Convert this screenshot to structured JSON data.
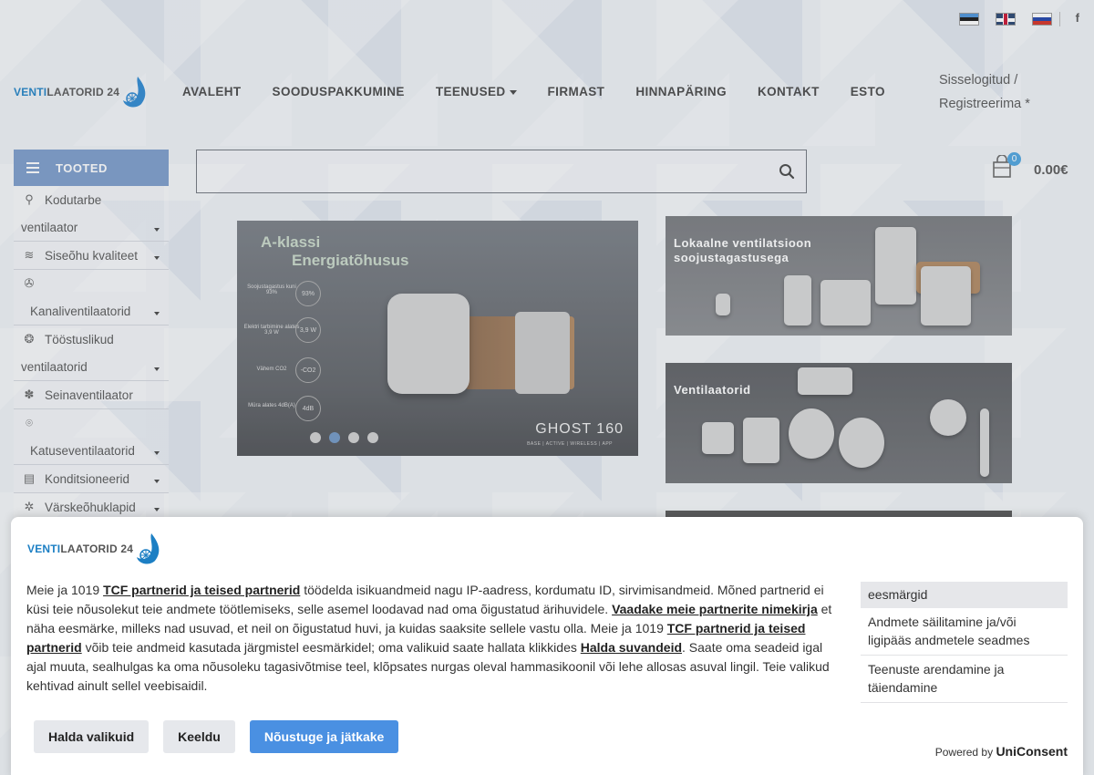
{
  "header": {
    "logo": {
      "part1": "VENTI",
      "part2": "LAATORID 24"
    },
    "flags": [
      "flag-estonia-icon",
      "flag-uk-icon",
      "flag-russia-icon"
    ],
    "social": "f",
    "nav": [
      {
        "label": "AVALEHT"
      },
      {
        "label": "SOODUSPAKKUMINE"
      },
      {
        "label": "TEENUSED",
        "dropdown": true
      },
      {
        "label": "FIRMAST"
      },
      {
        "label": "HINNAPÄRING"
      },
      {
        "label": "KONTAKT"
      },
      {
        "label": "ESTO"
      }
    ],
    "login": {
      "line1": "Sisselogitud /",
      "line2": "Registreerima *"
    },
    "cart": {
      "count": "0",
      "total": "0.00€"
    }
  },
  "sidebar": {
    "title": "TOOTED",
    "items": [
      {
        "line1": "Kodutarbe",
        "line2": "ventilaator"
      },
      {
        "line1": "Siseõhu kvaliteet"
      },
      {
        "line1": "",
        "line2": "Kanaliventilaatorid"
      },
      {
        "line1": "Tööstuslikud",
        "line2": "ventilaatorid"
      },
      {
        "line1": "Seinaventilaator"
      },
      {
        "line1": "",
        "line2": "Katuseventilaatorid"
      },
      {
        "line1": "Konditsioneerid"
      },
      {
        "line1": "Värskeõhuklapid"
      }
    ]
  },
  "banners": {
    "main": {
      "title_line1": "A-klassi",
      "title_line2": "Energiatõhusus",
      "product": "GHOST 160",
      "subtitle": "BASE | ACTIVE | WIRELESS | APP",
      "features": [
        {
          "label": "Soojustagastus kuni 93%",
          "value": "93%"
        },
        {
          "label": "Elektri tarbimine alates 3,9 W",
          "value": "3,9 W"
        },
        {
          "label": "Vähem CO2",
          "value": "-CO2"
        },
        {
          "label": "Müra alates 4dB(A)",
          "value": "4dB"
        }
      ]
    },
    "side1": {
      "title_line1": "Lokaalne ventilatsioon",
      "title_line2": "soojustagastusega"
    },
    "side2": {
      "title_line1": "Ventilaatorid"
    }
  },
  "consent": {
    "logo": {
      "part1": "VENTI",
      "part2": "LAATORID 24"
    },
    "t1": "Meie ja 1019 ",
    "link1": "TCF partnerid ja teised partnerid",
    "t2": " töödelda isikuandmeid nagu IP-aadress, kordumatu ID, sirvimisandmeid. Mõned partnerid ei küsi teie nõusolekut teie andmete töötlemiseks, selle asemel loodavad nad oma õigustatud ärihuvidele. ",
    "link2": "Vaadake meie partnerite nimekirja",
    "t3": " et näha eesmärke, milleks nad usuvad, et neil on õigustatud huvi, ja kuidas saaksite sellele vastu olla. Meie ja 1019 ",
    "link3": "TCF partnerid ja teised partnerid",
    "t4": " võib teie andmeid kasutada järgmistel eesmärkidel; oma valikuid saate hallata klikkides ",
    "link4": "Halda suvandeid",
    "t5": ". Saate oma seadeid igal ajal muuta, sealhulgas ka oma nõusoleku tagasivõtmise teel, klõpsates nurgas oleval hammasikoonil või lehe allosas asuval lingil. Teie valikud kehtivad ainult sellel veebisaidil.",
    "purposes_title": "eesmärgid",
    "purposes": [
      "Andmete säilitamine ja/või ligipääs andmetele seadmes",
      "Teenuste arendamine ja täiendamine"
    ],
    "buttons": {
      "manage": "Halda valikuid",
      "reject": "Keeldu",
      "accept": "Nõustuge ja jätkake"
    },
    "powered_by": "Powered by",
    "powered_brand": "UniConsent"
  },
  "colors": {
    "brand_blue": "#1c7fc4",
    "sidebar_head": "#7a9bc9",
    "accept_button": "#4a90e2",
    "cart_badge": "#4aa3df"
  }
}
